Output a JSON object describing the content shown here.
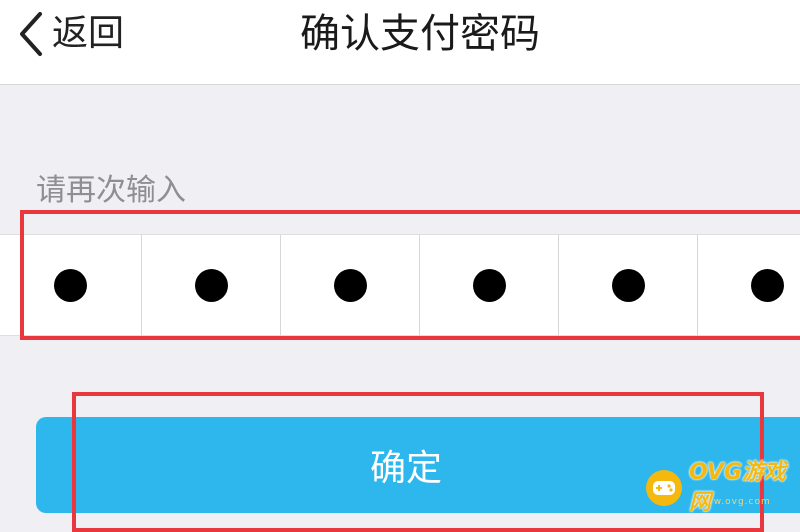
{
  "nav": {
    "back_label": "返回",
    "title": "确认支付密码"
  },
  "prompt": {
    "label": "请再次输入"
  },
  "pin": {
    "length": 6,
    "filled": 6,
    "masked_chars": [
      "●",
      "●",
      "●",
      "●",
      "●",
      "●"
    ]
  },
  "confirm": {
    "label": "确定"
  },
  "watermark": {
    "text": "OVG游戏网",
    "subtext": "www.ovg.com"
  },
  "colors": {
    "background": "#efeff4",
    "accent": "#2db7ec",
    "highlight": "#e8383d",
    "watermark": "#f5b80f"
  },
  "icons": {
    "back": "chevron-left-icon",
    "watermark_logo": "gamepad-icon"
  }
}
